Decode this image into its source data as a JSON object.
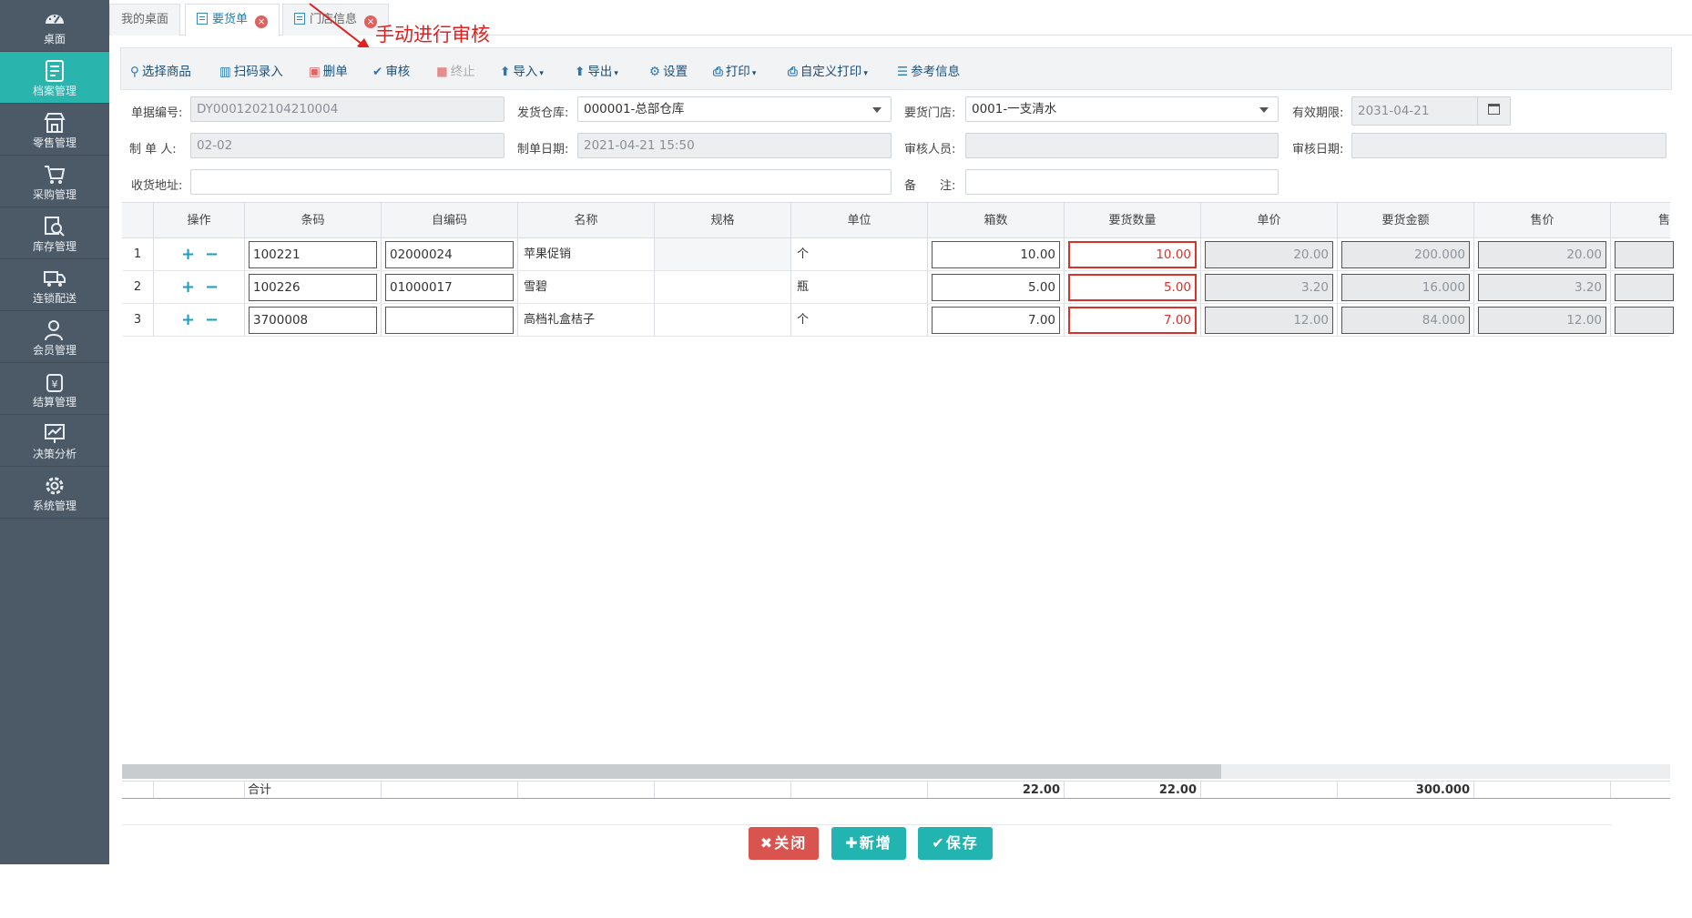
{
  "sidebar": {
    "items": [
      {
        "label": "桌面",
        "icon": "dashboard-icon"
      },
      {
        "label": "档案管理",
        "icon": "archive-icon"
      },
      {
        "label": "零售管理",
        "icon": "store-icon"
      },
      {
        "label": "采购管理",
        "icon": "cart-icon"
      },
      {
        "label": "库存管理",
        "icon": "inventory-icon"
      },
      {
        "label": "连锁配送",
        "icon": "truck-icon"
      },
      {
        "label": "会员管理",
        "icon": "user-icon"
      },
      {
        "label": "结算管理",
        "icon": "settlement-icon"
      },
      {
        "label": "决策分析",
        "icon": "chart-icon"
      },
      {
        "label": "系统管理",
        "icon": "gear-icon"
      }
    ]
  },
  "tabs": [
    {
      "label": "我的桌面"
    },
    {
      "label": "要货单"
    },
    {
      "label": "门店信息"
    }
  ],
  "annotation": "手动进行审核",
  "toolbar": {
    "select_goods": "选择商品",
    "scan_entry": "扫码录入",
    "delete_doc": "删单",
    "audit": "审核",
    "terminate": "终止",
    "import": "导入",
    "export": "导出",
    "settings": "设置",
    "print": "打印",
    "custom_print": "自定义打印",
    "reference": "参考信息"
  },
  "form": {
    "doc_no_label": "单据编号:",
    "doc_no": "DY0001202104210004",
    "warehouse_label": "发货仓库:",
    "warehouse": "000001-总部仓库",
    "store_label": "要货门店:",
    "store": "0001-一支清水",
    "valid_label": "有效期限:",
    "valid_date": "2031-04-21",
    "maker_label": "制 单 人:",
    "maker": "02-02",
    "make_date_label": "制单日期:",
    "make_date": "2021-04-21 15:50",
    "auditor_label": "审核人员:",
    "auditor": "",
    "audit_date_label": "审核日期:",
    "audit_date": "",
    "address_label": "收货地址:",
    "address": "",
    "remark_label": "备　　注:",
    "remark": ""
  },
  "grid": {
    "columns": [
      "操作",
      "条码",
      "自编码",
      "名称",
      "规格",
      "单位",
      "箱数",
      "要货数量",
      "单价",
      "要货金额",
      "售价",
      "售"
    ],
    "rows": [
      {
        "no": "1",
        "barcode": "100221",
        "code": "02000024",
        "name": "苹果促销",
        "spec": "",
        "unit": "个",
        "boxes": "10.00",
        "qty": "10.00",
        "price": "20.00",
        "amount": "200.000",
        "sale": "20.00"
      },
      {
        "no": "2",
        "barcode": "100226",
        "code": "01000017",
        "name": "雪碧",
        "spec": "",
        "unit": "瓶",
        "boxes": "5.00",
        "qty": "5.00",
        "price": "3.20",
        "amount": "16.000",
        "sale": "3.20"
      },
      {
        "no": "3",
        "barcode": "3700008",
        "code": "",
        "name": "高档礼盒桔子",
        "spec": "",
        "unit": "个",
        "boxes": "7.00",
        "qty": "7.00",
        "price": "12.00",
        "amount": "84.000",
        "sale": "12.00"
      }
    ],
    "total_label": "合计",
    "total_boxes": "22.00",
    "total_qty": "22.00",
    "total_amount": "300.000"
  },
  "footer": {
    "close": "关闭",
    "add": "新增",
    "save": "保存"
  },
  "colors": {
    "sidebar_bg": "#4c5a68",
    "accent": "#29b5ad",
    "danger": "#d9534f",
    "annotation": "#e02020"
  }
}
